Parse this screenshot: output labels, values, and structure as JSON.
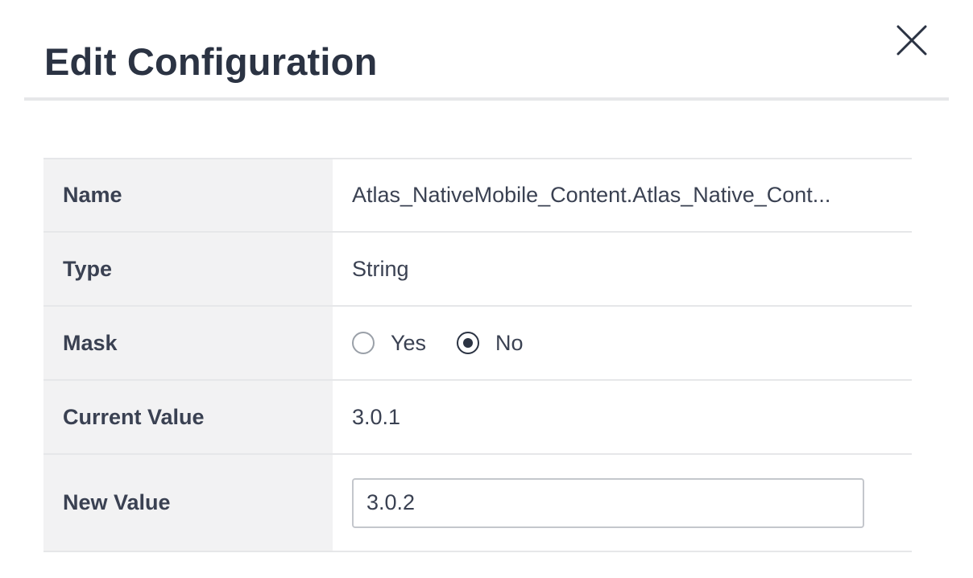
{
  "dialog": {
    "title": "Edit Configuration",
    "close_icon": "close-icon"
  },
  "fields": {
    "name": {
      "label": "Name",
      "value": "Atlas_NativeMobile_Content.Atlas_Native_Cont..."
    },
    "type": {
      "label": "Type",
      "value": "String"
    },
    "mask": {
      "label": "Mask",
      "options": [
        {
          "label": "Yes",
          "selected": false
        },
        {
          "label": "No",
          "selected": true
        }
      ]
    },
    "current_value": {
      "label": "Current Value",
      "value": "3.0.1"
    },
    "new_value": {
      "label": "New Value",
      "value": "3.0.2"
    }
  },
  "colors": {
    "title": "#2b3343",
    "label_background": "#f2f2f3",
    "divider": "#e6e7e9",
    "radio_checked": "#2b3343"
  }
}
